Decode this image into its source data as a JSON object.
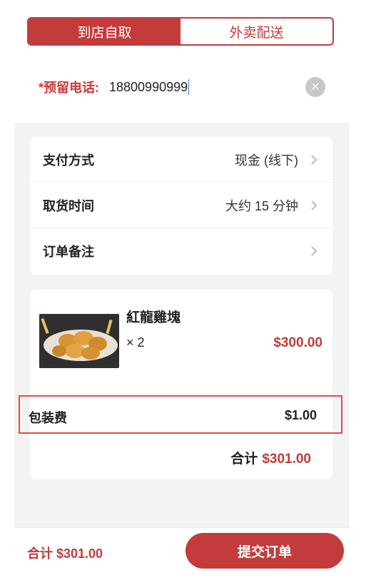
{
  "tabs": [
    {
      "label": "到店自取",
      "active": true
    },
    {
      "label": "外卖配送",
      "active": false
    }
  ],
  "phone": {
    "label": "*预留电话:",
    "value": "18800990999",
    "clear_icon": "close-circle-icon"
  },
  "options": [
    {
      "label": "支付方式",
      "value": "现金 (线下)"
    },
    {
      "label": "取货时间",
      "value": "大约 15 分钟"
    },
    {
      "label": "订单备注",
      "value": ""
    }
  ],
  "order": {
    "item": {
      "name": "紅龍雞塊",
      "qty": "× 2",
      "price": "$300.00",
      "image_icon": "chicken-nuggets-photo"
    },
    "packaging": {
      "label": "包装费",
      "value": "$1.00"
    },
    "subtotal": {
      "label": "合计",
      "value": "$301.00"
    }
  },
  "bottom": {
    "total": "合计 $301.00",
    "submit": "提交订单"
  },
  "colors": {
    "accent": "#c33b3b",
    "highlight": "#e34a4a"
  }
}
